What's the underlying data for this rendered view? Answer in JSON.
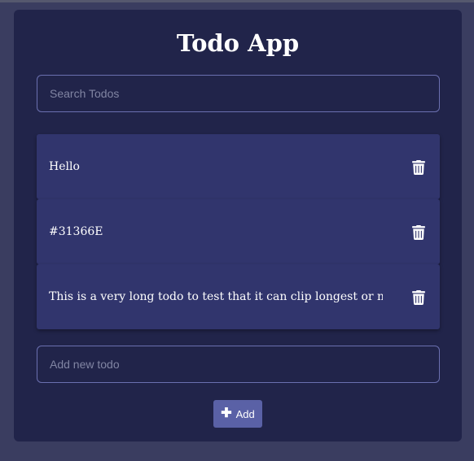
{
  "app": {
    "title": "Todo App"
  },
  "search": {
    "placeholder": "Search Todos",
    "value": ""
  },
  "todos": [
    {
      "text": "Hello",
      "delete_icon": "trash-icon"
    },
    {
      "text": "#31366E",
      "delete_icon": "trash-icon"
    },
    {
      "text": "This is a very long todo to test that it can clip longest or not",
      "delete_icon": "trash-icon"
    }
  ],
  "new_todo": {
    "placeholder": "Add new todo",
    "value": ""
  },
  "add_button": {
    "label": "Add",
    "icon": "plus-icon"
  },
  "colors": {
    "page_background": "#3a3d60",
    "card_background": "#21244a",
    "todo_item_background": "#31356d",
    "input_border": "#6b70b0",
    "button_background": "#5a61a6"
  }
}
